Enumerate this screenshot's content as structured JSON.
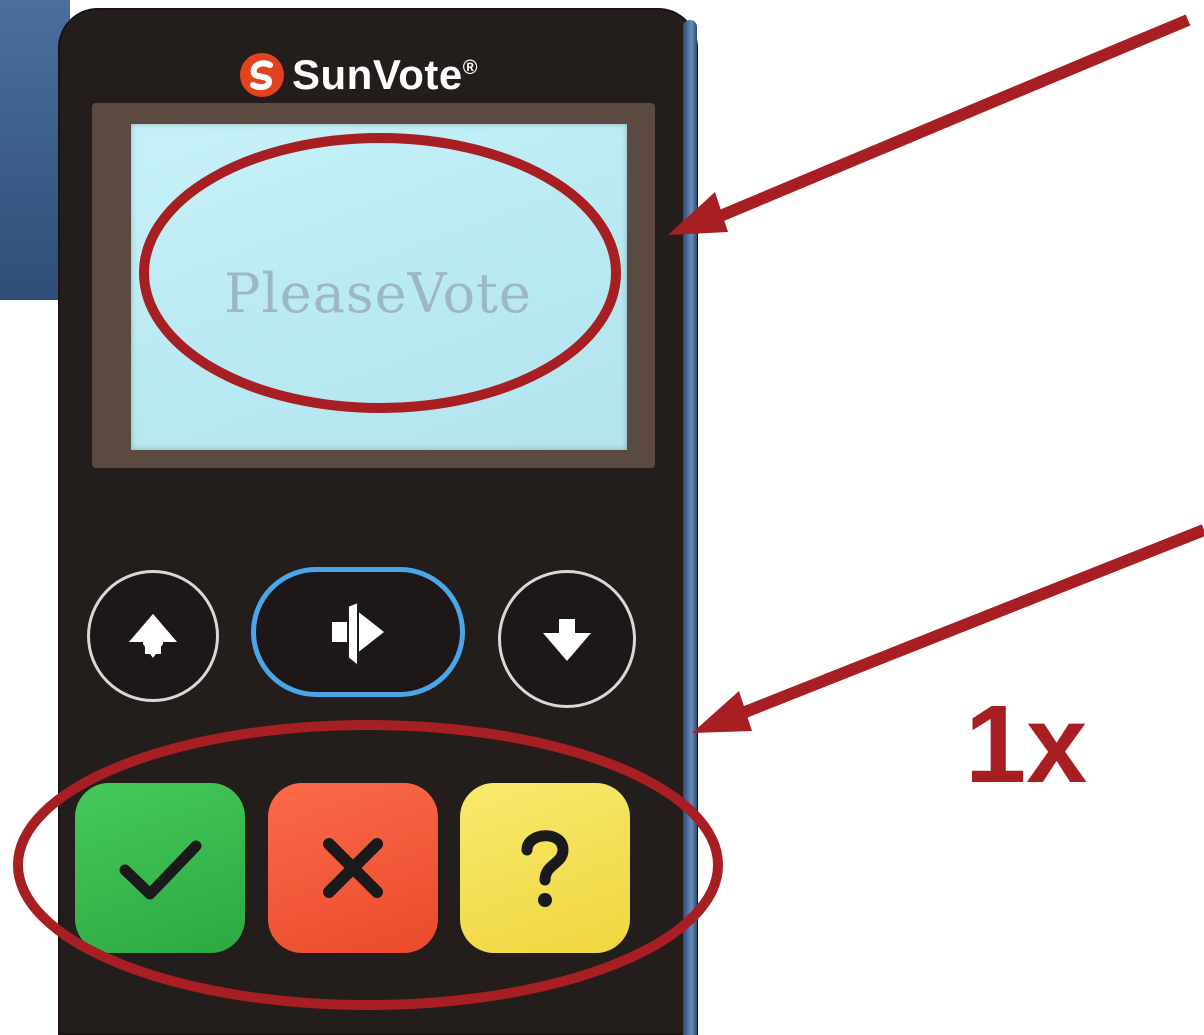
{
  "device": {
    "brand_name": "SunVote",
    "brand_mark": "®",
    "screen_text": "PleaseVote"
  },
  "nav_buttons": [
    {
      "icon": "arrow-up-icon"
    },
    {
      "icon": "enter-arrow-icon"
    },
    {
      "icon": "arrow-down-icon"
    }
  ],
  "vote_keys": [
    {
      "icon": "check-icon",
      "color": "#35b14a"
    },
    {
      "icon": "x-icon",
      "color": "#f0533a"
    },
    {
      "icon": "question-icon",
      "color": "#f2de52"
    }
  ],
  "annotation": {
    "label": "1x",
    "color": "#a71e23"
  }
}
